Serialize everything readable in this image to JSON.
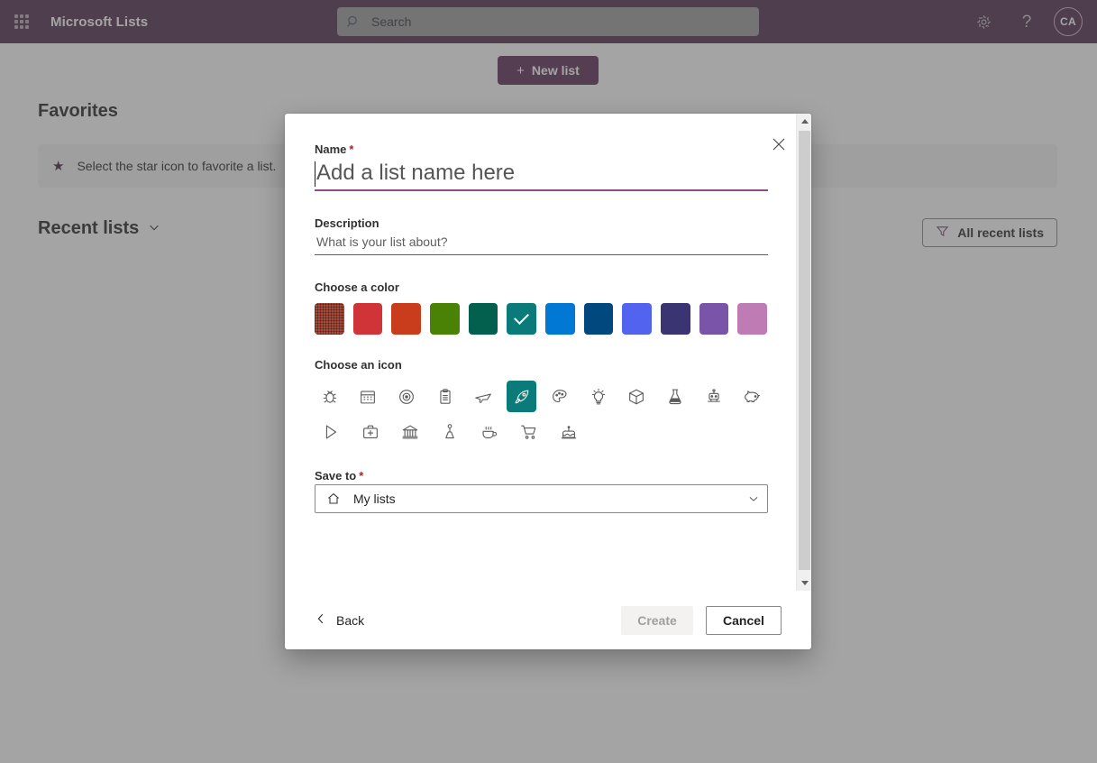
{
  "suite_bar": {
    "waffle_icon": "app-launcher-icon",
    "app_title": "Microsoft Lists",
    "search": {
      "placeholder": "Search",
      "value": "",
      "icon": "search-icon"
    },
    "settings_icon": "gear-icon",
    "help_icon": "question-mark-icon",
    "avatar_initials": "CA",
    "background_color": "#4f2a4c"
  },
  "page": {
    "new_list_button": {
      "label": "New list",
      "icon": "plus-icon",
      "color": "#5b2a55"
    },
    "favorites_title": "Favorites",
    "favorites_empty": {
      "icon": "star-icon",
      "text": "Select the star icon to favorite a list."
    },
    "recent_title": "Recent lists",
    "recent_chevron_icon": "chevron-down-icon",
    "all_recent_button": {
      "label": "All recent lists",
      "icon": "filter-icon"
    }
  },
  "dialog": {
    "close_icon": "close-icon",
    "name": {
      "label": "Name",
      "required_marker": "*",
      "placeholder": "Add a list name here",
      "value": "",
      "focus_underline_color": "#8f4d86"
    },
    "description": {
      "label": "Description",
      "placeholder": "What is your list about?",
      "value": ""
    },
    "color": {
      "label": "Choose a color",
      "selected_index": 5,
      "hovered_index": 0,
      "swatches": [
        {
          "name": "dark-red",
          "hex": "#a33a28"
        },
        {
          "name": "red",
          "hex": "#d13438"
        },
        {
          "name": "orange-red",
          "hex": "#ca3d1c"
        },
        {
          "name": "green",
          "hex": "#498205"
        },
        {
          "name": "dark-teal-green",
          "hex": "#03604f"
        },
        {
          "name": "teal",
          "hex": "#0b7b7a"
        },
        {
          "name": "blue",
          "hex": "#0078d4"
        },
        {
          "name": "dark-blue",
          "hex": "#00487e"
        },
        {
          "name": "royal-blue",
          "hex": "#5263ef"
        },
        {
          "name": "navy-purple",
          "hex": "#3b3472"
        },
        {
          "name": "purple",
          "hex": "#7a54a8"
        },
        {
          "name": "pink-orchid",
          "hex": "#bf7bb4"
        }
      ]
    },
    "icons": {
      "label": "Choose an icon",
      "selected": "rocket",
      "row1": [
        "bug",
        "calendar",
        "bullseye",
        "clipboard",
        "airplane",
        "rocket",
        "palette",
        "lightbulb",
        "cube",
        "beaker",
        "robot",
        "piggy-bank"
      ],
      "row2": [
        "play",
        "first-aid-kit",
        "bank",
        "joystick",
        "coffee-cup",
        "shopping-cart",
        "cake"
      ]
    },
    "save_to": {
      "label": "Save to",
      "required_marker": "*",
      "value": "My lists",
      "home_icon": "home-icon",
      "chevron_icon": "chevron-down-icon"
    },
    "footer": {
      "back_label": "Back",
      "back_icon": "chevron-left-icon",
      "create_label": "Create",
      "create_disabled": true,
      "cancel_label": "Cancel"
    },
    "scrollbar": {
      "up_icon": "scroll-up-arrow",
      "down_icon": "scroll-down-arrow"
    }
  }
}
